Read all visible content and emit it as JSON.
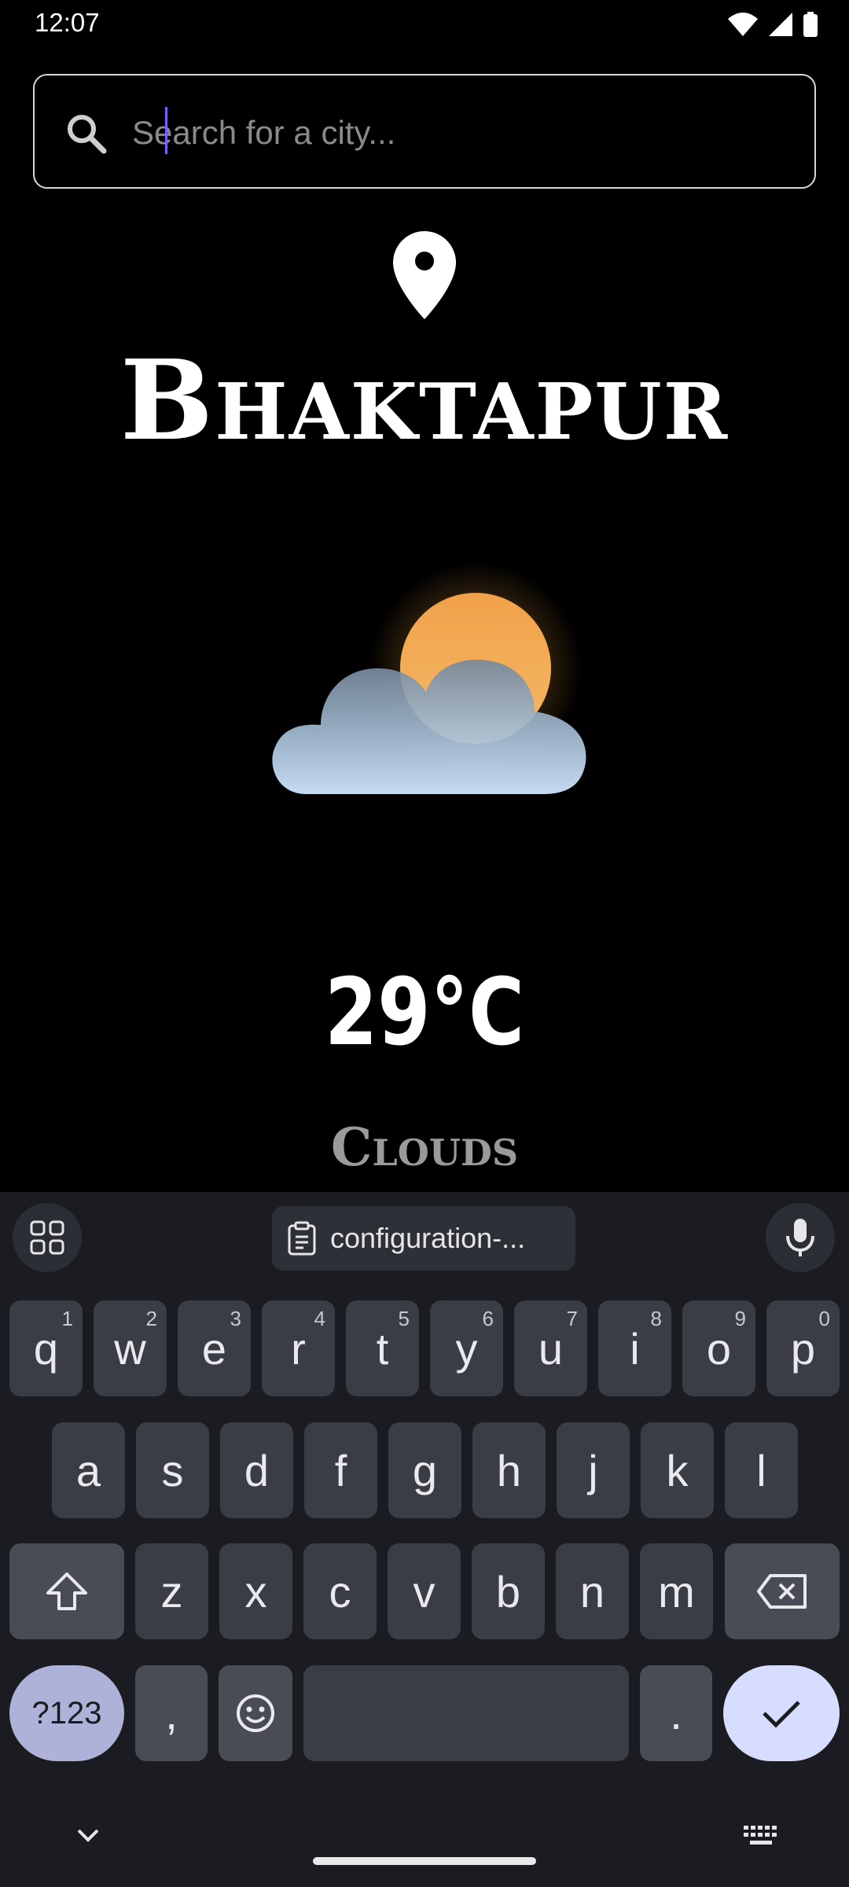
{
  "status_bar": {
    "time": "12:07"
  },
  "search": {
    "placeholder": "Search for a city..."
  },
  "location": {
    "city": "Bhaktapur"
  },
  "weather": {
    "temperature": "29°C",
    "condition": "Clouds",
    "icon": "partly-cloudy-icon"
  },
  "keyboard": {
    "clipboard_suggestion": "configuration-...",
    "row1": [
      {
        "label": "q",
        "hint": "1"
      },
      {
        "label": "w",
        "hint": "2"
      },
      {
        "label": "e",
        "hint": "3"
      },
      {
        "label": "r",
        "hint": "4"
      },
      {
        "label": "t",
        "hint": "5"
      },
      {
        "label": "y",
        "hint": "6"
      },
      {
        "label": "u",
        "hint": "7"
      },
      {
        "label": "i",
        "hint": "8"
      },
      {
        "label": "o",
        "hint": "9"
      },
      {
        "label": "p",
        "hint": "0"
      }
    ],
    "row2": [
      "a",
      "s",
      "d",
      "f",
      "g",
      "h",
      "j",
      "k",
      "l"
    ],
    "row3": [
      "z",
      "x",
      "c",
      "v",
      "b",
      "n",
      "m"
    ],
    "symbols_label": "?123",
    "comma_label": ",",
    "period_label": "."
  },
  "colors": {
    "background": "#000000",
    "keyboard_bg": "#1b1c22",
    "key_bg": "#3b3d46",
    "accent": "#d7ddff",
    "caret": "#7a5cff"
  }
}
